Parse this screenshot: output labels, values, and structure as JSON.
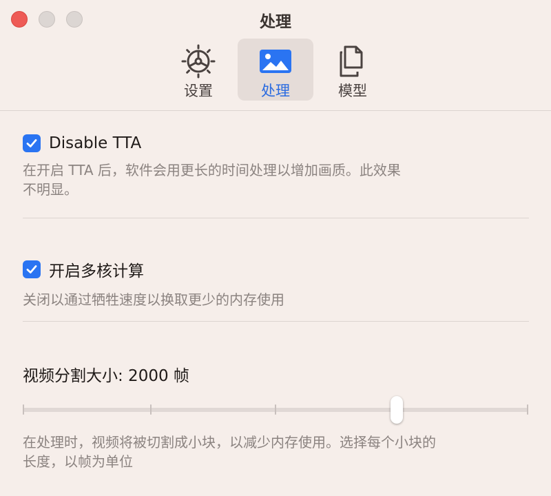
{
  "window": {
    "title": "处理"
  },
  "tabs": [
    {
      "label": "设置",
      "icon": "gear-icon",
      "active": false
    },
    {
      "label": "处理",
      "icon": "photo-icon",
      "active": true
    },
    {
      "label": "模型",
      "icon": "documents-icon",
      "active": false
    }
  ],
  "options": {
    "disable_tta": {
      "label": "Disable TTA",
      "checked": true,
      "description": [
        "在开启 TTA 后，软件会用更长的时间处理以增加画质。此效果",
        "不明显。"
      ]
    },
    "multicore": {
      "label": "开启多核计算",
      "checked": true,
      "description": "关闭以通过牺牲速度以换取更少的内存使用"
    }
  },
  "segment_size": {
    "label": "视频分割大小: 2000 帧",
    "slider_position": 0.74,
    "description": [
      "在处理时，视频将被切割成小块，以减少内存使用。选择每个小块的",
      "长度，以帧为单位"
    ]
  },
  "colors": {
    "accent": "#2a74f2",
    "close": "#ee5b56",
    "background": "#f6eeea"
  }
}
